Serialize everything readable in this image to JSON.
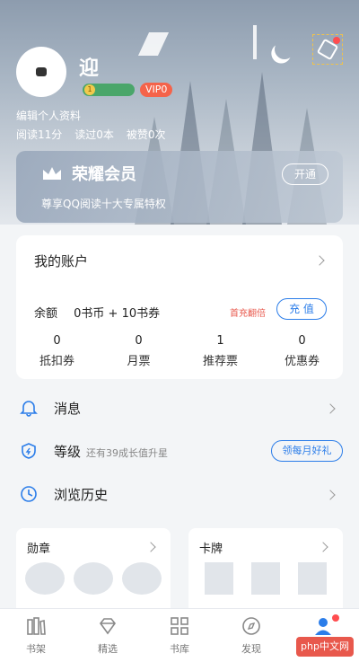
{
  "header": {
    "nickname": "迎",
    "level_badge": "1",
    "vip_badge": "VIP0",
    "edit_profile": "编辑个人资料",
    "stats": [
      "阅读11分",
      "读过0本",
      "被赞0次"
    ]
  },
  "vip_card": {
    "title": "荣耀会员",
    "subtitle": "尊享QQ阅读十大专属特权",
    "button": "开通"
  },
  "account": {
    "title": "我的账户",
    "balance_label": "余额",
    "balance_value": "0书币 + 10书券",
    "first_charge": "首充翻倍",
    "recharge_button": "充 值",
    "coupons": [
      {
        "value": "0",
        "label": "抵扣券"
      },
      {
        "value": "0",
        "label": "月票"
      },
      {
        "value": "1",
        "label": "推荐票"
      },
      {
        "value": "0",
        "label": "优惠券"
      }
    ]
  },
  "menu": {
    "messages": "消息",
    "level": "等级",
    "level_sub": "还有39成长值升星",
    "monthly_gift": "领每月好礼",
    "history": "浏览历史"
  },
  "bottom_cards": {
    "medals": "勋章",
    "cards": "卡牌"
  },
  "bottom_nav": [
    {
      "label": "书架",
      "icon": "bookshelf-icon"
    },
    {
      "label": "精选",
      "icon": "diamond-icon"
    },
    {
      "label": "书库",
      "icon": "grid-icon"
    },
    {
      "label": "发现",
      "icon": "compass-icon"
    },
    {
      "label": "",
      "icon": "profile-icon"
    }
  ],
  "watermark": "php中文网",
  "colors": {
    "accent": "#2b7de9",
    "vip": "#f5634a",
    "alert": "#e8584c"
  }
}
